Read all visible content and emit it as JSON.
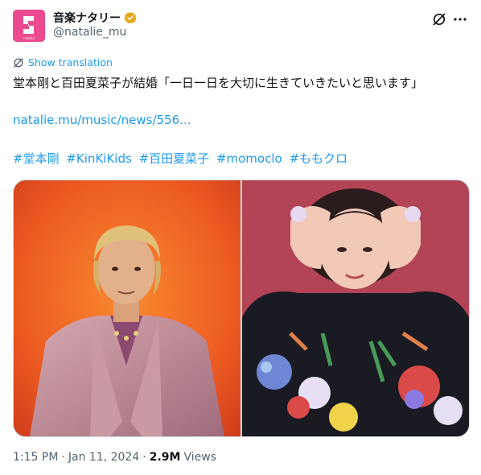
{
  "account": {
    "display_name": "音楽ナタリー",
    "handle": "@natalie_mu",
    "avatar_label": "natalie",
    "verified_color": "#e6a817"
  },
  "actions": {
    "show_translation": "Show translation"
  },
  "tweet": {
    "text": "堂本剛と百田夏菜子が結婚「一日一日を大切に生きていきたいと思います」",
    "link": "natalie.mu/music/news/556...",
    "hashtags": [
      "#堂本剛",
      "#KinKiKids",
      "#百田夏菜子",
      "#momoclo",
      "#ももクロ"
    ]
  },
  "meta": {
    "time": "1:15 PM",
    "separator1": "·",
    "date": "Jan 11, 2024",
    "separator2": "·",
    "views_count": "2.9M",
    "views_label": "Views"
  },
  "colors": {
    "accent": "#1d9bf0",
    "secondary_text": "#536471",
    "avatar_bg": "#ec4a8e"
  }
}
